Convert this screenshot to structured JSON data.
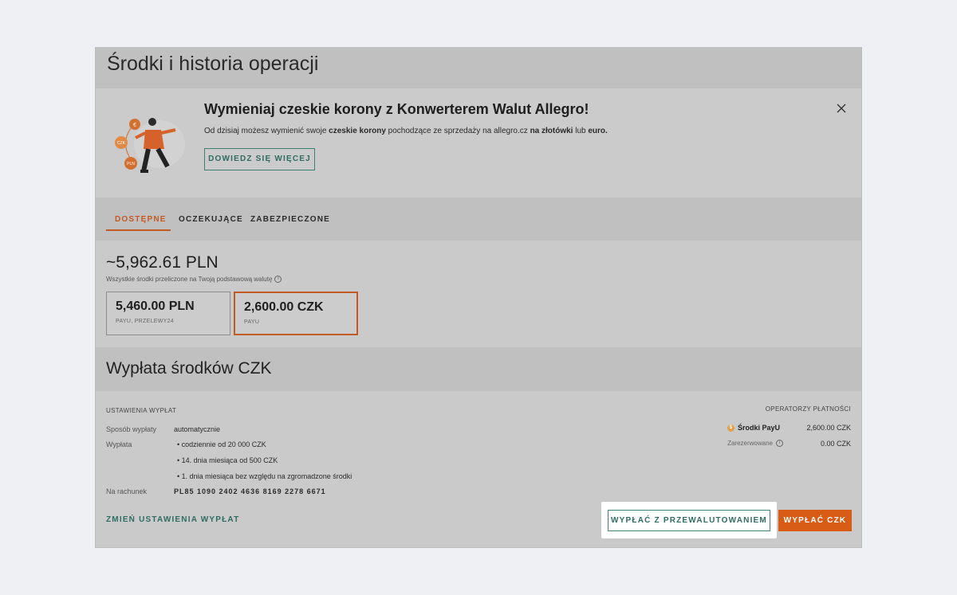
{
  "page": {
    "title": "Środki i historia operacji"
  },
  "banner": {
    "title": "Wymieniaj czeskie korony z Konwerterem Walut Allegro!",
    "text_parts": [
      "Od dzisiaj możesz wymienić swoje ",
      "czeskie korony",
      " pochodzące ze sprzedaży na allegro.cz ",
      "na złotówki",
      " lub ",
      "euro."
    ],
    "learn_more": "DOWIEDZ SIĘ WIĘCEJ",
    "illustration_labels": [
      "€",
      "CZK",
      "PLN"
    ]
  },
  "tabs": [
    {
      "label": "DOSTĘPNE",
      "active": true
    },
    {
      "label": "OCZEKUJĄCE",
      "active": false
    },
    {
      "label": "ZABEZPIECZONE",
      "active": false
    }
  ],
  "funds": {
    "total": "~5,962.61 PLN",
    "note": "Wszystkie środki przeliczone na Twoją podstawową walutę",
    "wallets": [
      {
        "amount": "5,460.00 PLN",
        "sub": "PAYU, PRZELEWY24",
        "selected": false
      },
      {
        "amount": "2,600.00 CZK",
        "sub": "PAYU",
        "selected": true
      }
    ]
  },
  "payout": {
    "title": "Wypłata środków CZK",
    "settings_label": "USTAWIENIA WYPŁAT",
    "method_key": "Sposób wypłaty",
    "method_val": "automatycznie",
    "payout_key": "Wypłata",
    "bullets": [
      "• codziennie od 20 000 CZK",
      "• 14. dnia miesiąca od 500 CZK",
      "• 1. dnia miesiąca bez względu na zgromadzone środki"
    ],
    "account_key": "Na rachunek",
    "account_val": "PL85 1090 2402 4636 8169 2278 6671",
    "change_link": "ZMIEŃ USTAWIENIA WYPŁAT",
    "operators_label": "OPERATORZY PŁATNOŚCI",
    "operator_name": "Środki PayU",
    "operator_val": "2,600.00 CZK",
    "reserved_label": "Zarezerwowane",
    "reserved_val": "0.00 CZK",
    "convert_button": "WYPŁAĆ Z PRZEWALUTOWANIEM",
    "pay_button": "WYPŁAĆ CZK"
  },
  "colors": {
    "accent": "#d95c16",
    "teal": "#2f6c62"
  }
}
